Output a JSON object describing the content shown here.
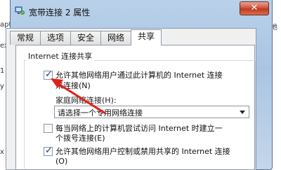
{
  "background": {
    "left_fragments": [
      "apt",
      "",
      "ex",
      "1",
      "y",
      "x"
    ],
    "right_fragments": [
      "地"
    ]
  },
  "window": {
    "title": "宽带连接 2 属性",
    "close_symbol": "✕"
  },
  "tabs": [
    {
      "label": "常规"
    },
    {
      "label": "选项"
    },
    {
      "label": "安全"
    },
    {
      "label": "网络"
    },
    {
      "label": "共享",
      "active": true
    }
  ],
  "sharing": {
    "group_title": "Internet 连接共享",
    "allow_share": {
      "checked": true,
      "label_line1": "允许其他网络用户通过此计算机的 Internet 连接",
      "label_line2": "来连接(N)"
    },
    "home_network_label": "家庭网络连接(H):",
    "home_network_select": "请选择一个专用网络连接",
    "dial_on_demand": {
      "checked": false,
      "label_line1": "每当网络上的计算机尝试访问 Internet 时建立一",
      "label_line2": "个拨号连接(E)"
    },
    "allow_control": {
      "checked": true,
      "label_line1": "允许其他网络用户控制或禁用共享的 Internet 连接",
      "label_line2": "(O)"
    }
  },
  "colors": {
    "annotation_arrow": "#e0201c",
    "titlebar": "#b9d1ea",
    "close_button": "#c8452a"
  }
}
